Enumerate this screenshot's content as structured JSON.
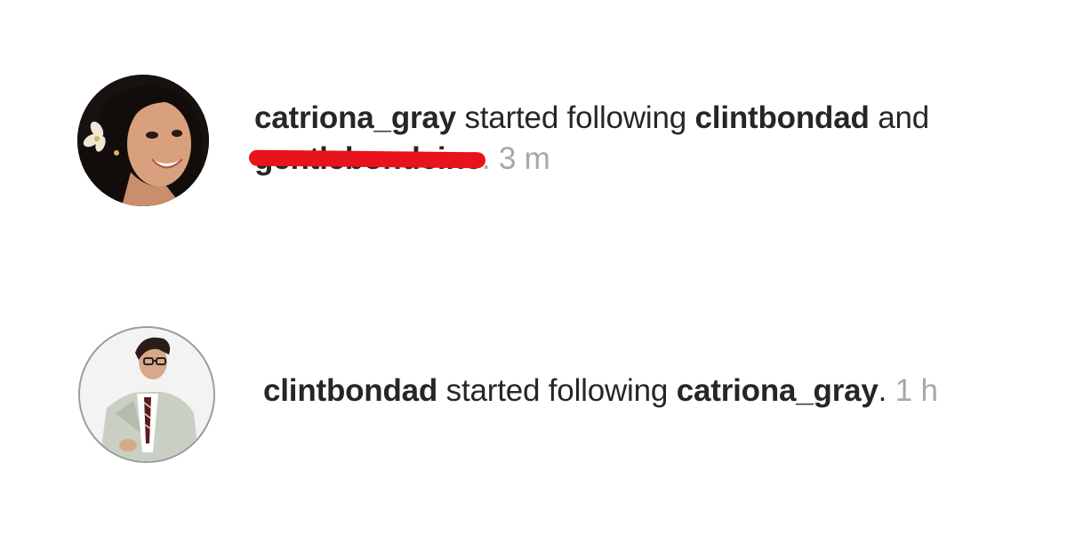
{
  "activities": [
    {
      "actor": "catriona_gray",
      "action": "started following",
      "target": "clintbondad",
      "joiner": "and",
      "second_target": "gentlebondeine",
      "period": ".",
      "time": "3 m",
      "avatar_icon": "woman-profile-photo"
    },
    {
      "actor": "clintbondad",
      "action": "started following",
      "target": "catriona_gray",
      "period": ".",
      "time": "1 h",
      "avatar_icon": "man-in-suit-profile-photo"
    }
  ],
  "colors": {
    "text": "#262626",
    "timestamp": "#a8a8a8",
    "redaction": "#e8131b",
    "background": "#ffffff"
  }
}
